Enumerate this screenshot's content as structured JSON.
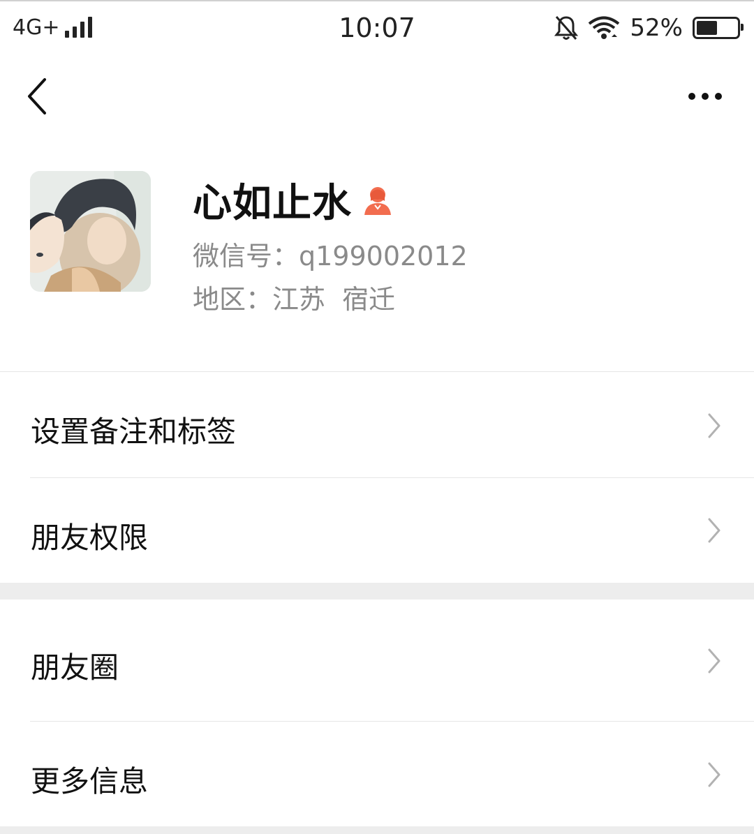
{
  "status_bar": {
    "network": "4G+",
    "time": "10:07",
    "battery_percent_text": "52%",
    "battery_level": 0.52,
    "icons": [
      "signal-icon",
      "mute-bell-icon",
      "wifi-icon",
      "battery-icon"
    ]
  },
  "nav": {
    "back_icon": "chevron-left-icon",
    "more_icon": "more-dots-icon"
  },
  "profile": {
    "name": "心如止水",
    "gender_icon": "female-icon",
    "gender_color": "#f26d4f",
    "wechat_id": "微信号：q199002012",
    "region_label": "地区：",
    "region_province": "江苏",
    "region_city": "宿迁"
  },
  "menu_group_1": [
    {
      "label": "设置备注和标签"
    },
    {
      "label": "朋友权限"
    }
  ],
  "menu_group_2": [
    {
      "label": "朋友圈"
    },
    {
      "label": "更多信息"
    }
  ],
  "colors": {
    "background": "#ffffff",
    "separator_band": "#ededed",
    "secondary_text": "#8a8a8a",
    "chevron": "#b2b2b2"
  }
}
